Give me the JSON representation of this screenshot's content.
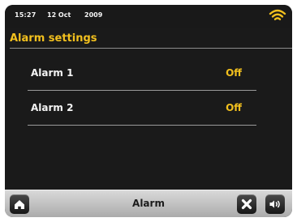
{
  "status": {
    "time": "15:27",
    "date": "12 Oct",
    "year": "2009",
    "wifi_icon": "wifi-icon"
  },
  "header": {
    "title": "Alarm settings"
  },
  "alarms": [
    {
      "label": "Alarm 1",
      "value": "Off"
    },
    {
      "label": "Alarm 2",
      "value": "Off"
    }
  ],
  "footer": {
    "label": "Alarm",
    "home_icon": "home-icon",
    "close_icon": "close-icon",
    "volume_icon": "volume-icon"
  },
  "colors": {
    "accent": "#f2c01e",
    "screen_bg": "#1a1a1a",
    "text": "#f4f4f4"
  }
}
